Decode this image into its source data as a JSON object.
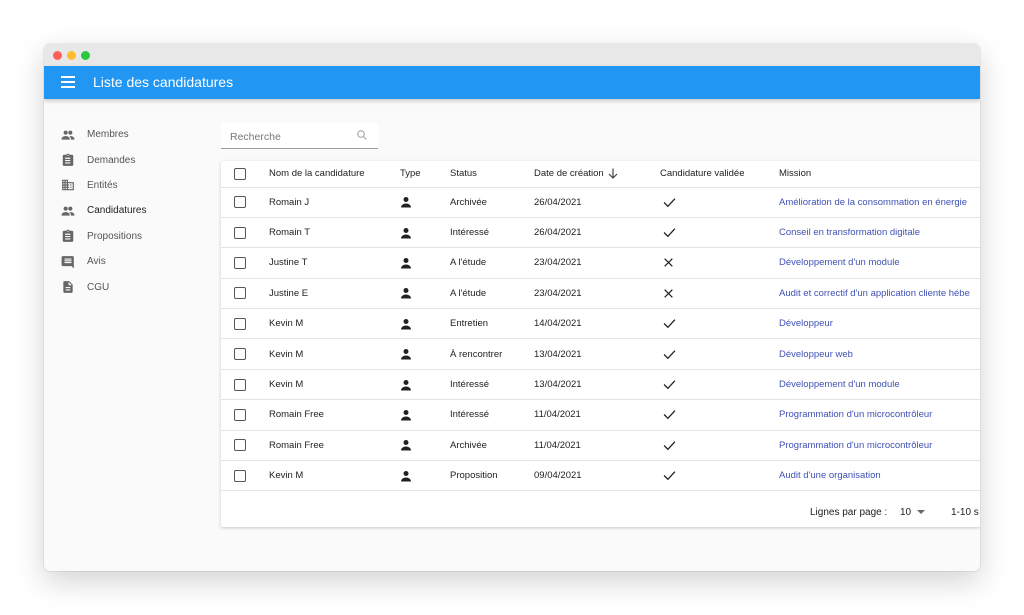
{
  "app": {
    "title": "Liste des candidatures"
  },
  "sidebar": {
    "items": [
      {
        "label": "Membres",
        "icon": "people-icon"
      },
      {
        "label": "Demandes",
        "icon": "clipboard-icon"
      },
      {
        "label": "Entités",
        "icon": "business-icon"
      },
      {
        "label": "Candidatures",
        "icon": "people-icon",
        "active": true
      },
      {
        "label": "Propositions",
        "icon": "clipboard-icon"
      },
      {
        "label": "Avis",
        "icon": "comment-icon"
      },
      {
        "label": "CGU",
        "icon": "document-icon"
      }
    ]
  },
  "search": {
    "placeholder": "Recherche"
  },
  "table": {
    "headers": {
      "name": "Nom de la candidature",
      "type": "Type",
      "status": "Status",
      "date": "Date de création",
      "valid": "Candidature validée",
      "mission": "Mission"
    },
    "rows": [
      {
        "name": "Romain J",
        "status": "Archivée",
        "date": "26/04/2021",
        "valid": true,
        "mission": "Amélioration de la consommation en énergie"
      },
      {
        "name": "Romain T",
        "status": "Intéressé",
        "date": "26/04/2021",
        "valid": true,
        "mission": "Conseil en transformation digitale"
      },
      {
        "name": "Justine T",
        "status": "A l'étude",
        "date": "23/04/2021",
        "valid": false,
        "mission": "Développement d'un module"
      },
      {
        "name": "Justine E",
        "status": "A l'étude",
        "date": "23/04/2021",
        "valid": false,
        "mission": "Audit et correctif d'un application cliente hébe"
      },
      {
        "name": "Kevin M",
        "status": "Entretien",
        "date": "14/04/2021",
        "valid": true,
        "mission": "Développeur"
      },
      {
        "name": "Kevin M",
        "status": "À rencontrer",
        "date": "13/04/2021",
        "valid": true,
        "mission": "Développeur web"
      },
      {
        "name": "Kevin M",
        "status": "Intéressé",
        "date": "13/04/2021",
        "valid": true,
        "mission": "Développement d'un module"
      },
      {
        "name": "Romain Free",
        "status": "Intéressé",
        "date": "11/04/2021",
        "valid": true,
        "mission": "Programmation d'un microcontrôleur"
      },
      {
        "name": "Romain Free",
        "status": "Archivée",
        "date": "11/04/2021",
        "valid": true,
        "mission": "Programmation d'un microcontrôleur"
      },
      {
        "name": "Kevin M",
        "status": "Proposition",
        "date": "09/04/2021",
        "valid": true,
        "mission": "Audit d'une organisation"
      }
    ]
  },
  "pagination": {
    "label": "Lignes par page :",
    "per_page": "10",
    "range": "1-10 s"
  },
  "colors": {
    "appbar": "#2196f3",
    "link": "#3f51b5"
  }
}
